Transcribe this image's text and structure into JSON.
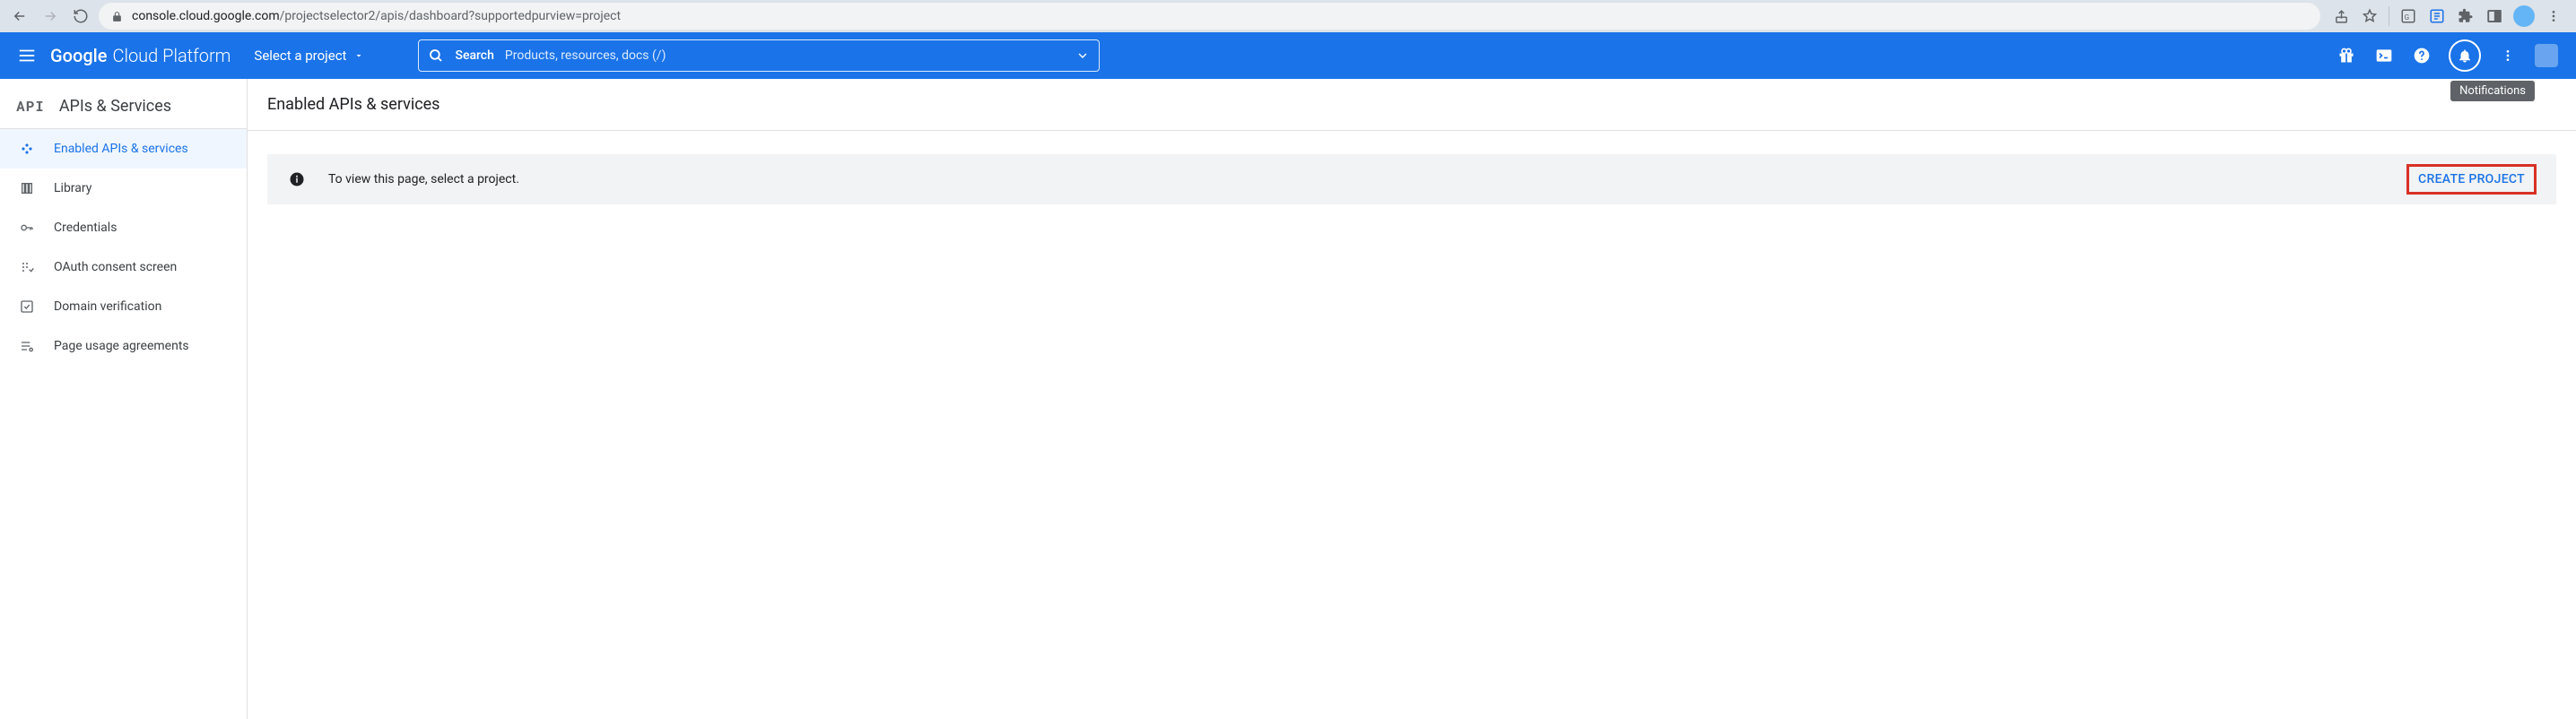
{
  "browser": {
    "url_host": "console.cloud.google.com",
    "url_path": "/projectselector2/apis/dashboard?supportedpurview=project"
  },
  "header": {
    "logo_google": "Google",
    "logo_rest": "Cloud Platform",
    "project_picker": "Select a project",
    "search_label": "Search",
    "search_placeholder": "Products, resources, docs (/)"
  },
  "tooltip": "Notifications",
  "sidebar": {
    "section_logo": "API",
    "section_title": "APIs & Services",
    "items": [
      {
        "label": "Enabled APIs & services"
      },
      {
        "label": "Library"
      },
      {
        "label": "Credentials"
      },
      {
        "label": "OAuth consent screen"
      },
      {
        "label": "Domain verification"
      },
      {
        "label": "Page usage agreements"
      }
    ]
  },
  "main": {
    "title": "Enabled APIs & services",
    "banner_message": "To view this page, select a project.",
    "create_project": "CREATE PROJECT"
  }
}
